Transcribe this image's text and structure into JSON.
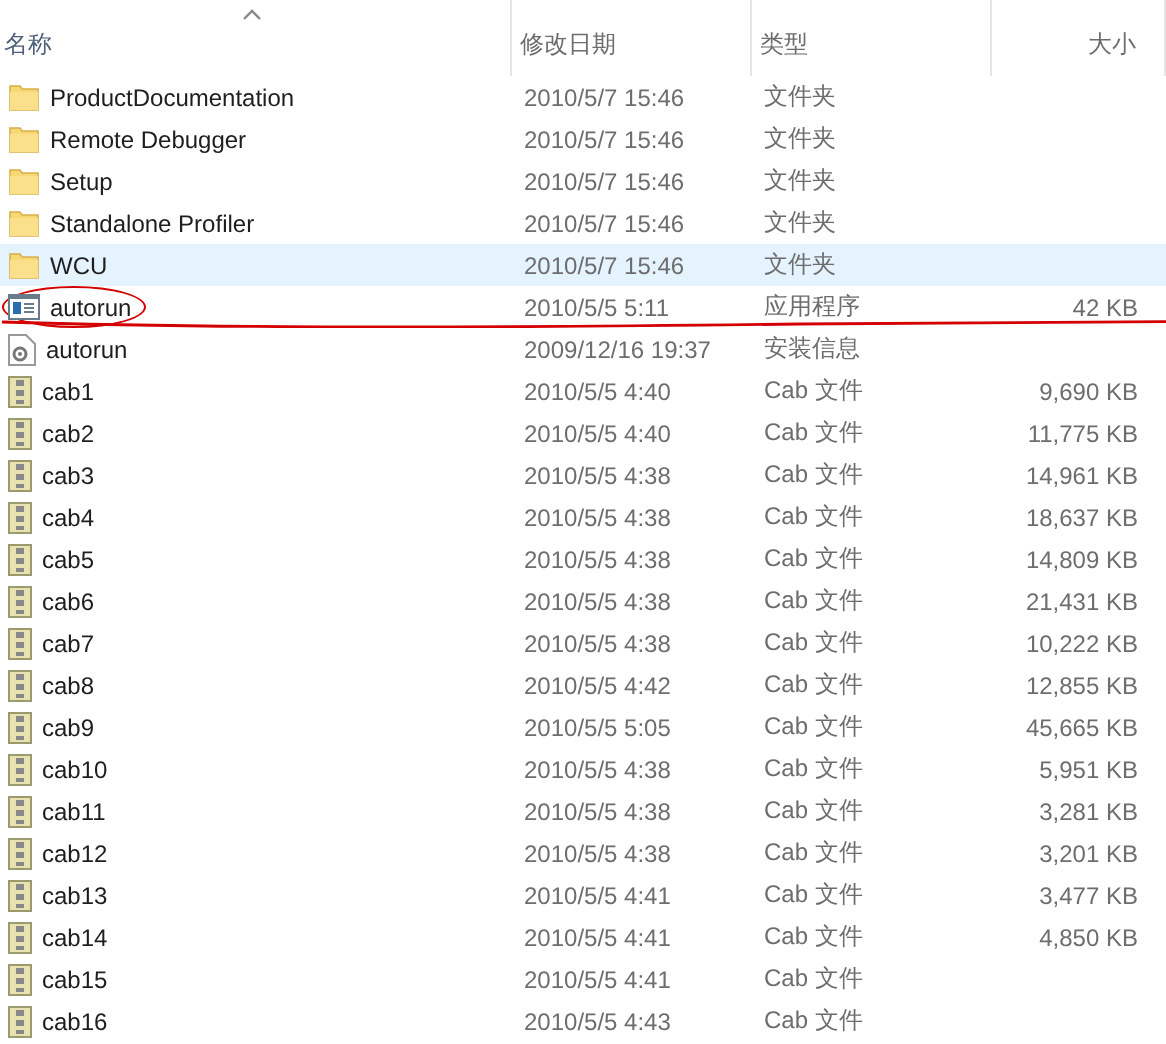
{
  "columns": [
    {
      "label": "名称",
      "sorted": true
    },
    {
      "label": "修改日期"
    },
    {
      "label": "类型"
    },
    {
      "label": "大小"
    }
  ],
  "rows": [
    {
      "kind": "folder",
      "name": "ProductDocumentation",
      "date": "2010/5/7 15:46",
      "type": "文件夹",
      "selected": false
    },
    {
      "kind": "folder",
      "name": "Remote Debugger",
      "date": "2010/5/7 15:46",
      "type": "文件夹",
      "selected": false
    },
    {
      "kind": "folder",
      "name": "Setup",
      "date": "2010/5/7 15:46",
      "type": "文件夹",
      "selected": false
    },
    {
      "kind": "folder",
      "name": "Standalone Profiler",
      "date": "2010/5/7 15:46",
      "type": "文件夹",
      "selected": false
    },
    {
      "kind": "folder",
      "name": "WCU",
      "date": "2010/5/7 15:46",
      "type": "文件夹",
      "selected": true
    },
    {
      "kind": "app",
      "name": "autorun",
      "date": "2010/5/5 5:11",
      "type": "应用程序",
      "size": "42 KB",
      "selected": false,
      "circled": true
    },
    {
      "kind": "setup",
      "name": "autorun",
      "date": "2009/12/16 19:37",
      "type": "安装信息",
      "selected": false
    },
    {
      "kind": "cab",
      "name": "cab1",
      "date": "2010/5/5 4:40",
      "type": "Cab 文件",
      "size": "9,690 KB",
      "selected": false
    },
    {
      "kind": "cab",
      "name": "cab2",
      "date": "2010/5/5 4:40",
      "type": "Cab 文件",
      "size": "11,775 KB",
      "selected": false
    },
    {
      "kind": "cab",
      "name": "cab3",
      "date": "2010/5/5 4:38",
      "type": "Cab 文件",
      "size": "14,961 KB",
      "selected": false
    },
    {
      "kind": "cab",
      "name": "cab4",
      "date": "2010/5/5 4:38",
      "type": "Cab 文件",
      "size": "18,637 KB",
      "selected": false
    },
    {
      "kind": "cab",
      "name": "cab5",
      "date": "2010/5/5 4:38",
      "type": "Cab 文件",
      "size": "14,809 KB",
      "selected": false
    },
    {
      "kind": "cab",
      "name": "cab6",
      "date": "2010/5/5 4:38",
      "type": "Cab 文件",
      "size": "21,431 KB",
      "selected": false
    },
    {
      "kind": "cab",
      "name": "cab7",
      "date": "2010/5/5 4:38",
      "type": "Cab 文件",
      "size": "10,222 KB",
      "selected": false
    },
    {
      "kind": "cab",
      "name": "cab8",
      "date": "2010/5/5 4:42",
      "type": "Cab 文件",
      "size": "12,855 KB",
      "selected": false
    },
    {
      "kind": "cab",
      "name": "cab9",
      "date": "2010/5/5 5:05",
      "type": "Cab 文件",
      "size": "45,665 KB",
      "selected": false
    },
    {
      "kind": "cab",
      "name": "cab10",
      "date": "2010/5/5 4:38",
      "type": "Cab 文件",
      "size": "5,951 KB",
      "selected": false
    },
    {
      "kind": "cab",
      "name": "cab11",
      "date": "2010/5/5 4:38",
      "type": "Cab 文件",
      "size": "3,281 KB",
      "selected": false
    },
    {
      "kind": "cab",
      "name": "cab12",
      "date": "2010/5/5 4:38",
      "type": "Cab 文件",
      "size": "3,201 KB",
      "selected": false
    },
    {
      "kind": "cab",
      "name": "cab13",
      "date": "2010/5/5 4:41",
      "type": "Cab 文件",
      "size": "3,477 KB",
      "selected": false
    },
    {
      "kind": "cab",
      "name": "cab14",
      "date": "2010/5/5 4:41",
      "type": "Cab 文件",
      "size": "4,850 KB",
      "selected": false
    },
    {
      "kind": "cab",
      "name": "cab15",
      "date": "2010/5/5 4:41",
      "type": "Cab 文件",
      "selected": false
    },
    {
      "kind": "cab",
      "name": "cab16",
      "date": "2010/5/5 4:43",
      "type": "Cab 文件",
      "selected": false
    }
  ]
}
